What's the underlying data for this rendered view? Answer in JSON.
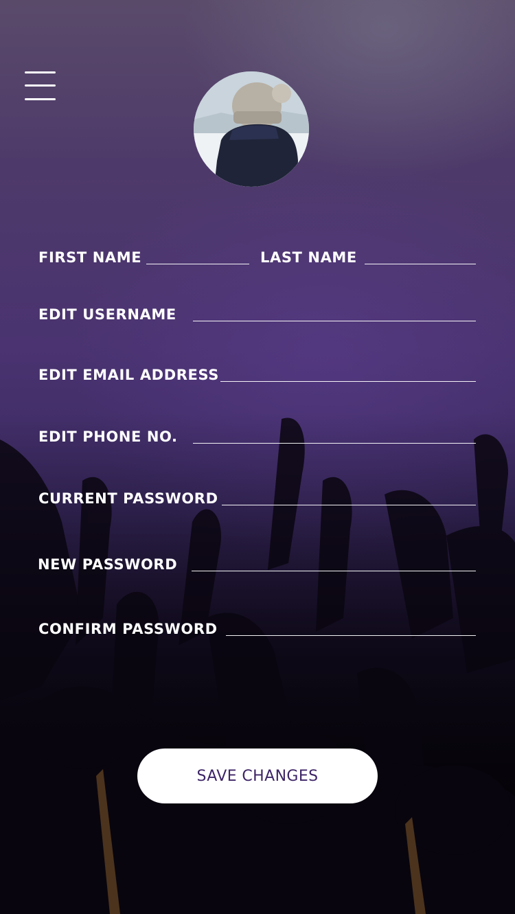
{
  "menu": {
    "icon": "hamburger-menu-icon"
  },
  "profile": {
    "avatar": "profile-photo-avatar"
  },
  "form": {
    "first_name_label": "FIRST NAME",
    "last_name_label": "LAST NAME",
    "username_label": "EDIT USERNAME",
    "email_label": "EDIT EMAIL ADDRESS",
    "phone_label": "EDIT PHONE NO.",
    "current_password_label": "CURRENT PASSWORD",
    "new_password_label": "NEW PASSWORD",
    "confirm_password_label": "CONFIRM PASSWORD"
  },
  "actions": {
    "save_label": "SAVE CHANGES"
  },
  "colors": {
    "background": "#4a3370",
    "text": "#ffffff",
    "button_bg": "#ffffff",
    "button_text": "#3d2466"
  }
}
